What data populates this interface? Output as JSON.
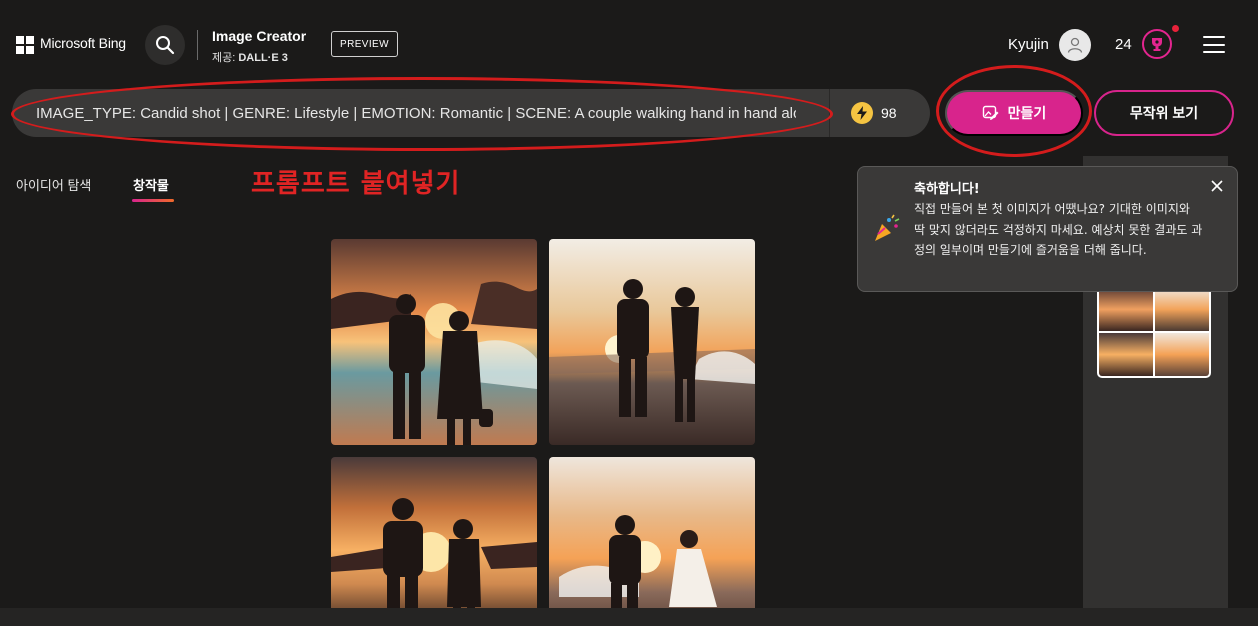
{
  "header": {
    "brand": "Microsoft Bing",
    "product_title": "Image Creator",
    "product_sub_prefix": "제공: ",
    "product_sub_model": "DALL·E 3",
    "preview_badge": "PREVIEW",
    "user_name": "Kyujin",
    "reward_points": "24"
  },
  "prompt": {
    "value": "IMAGE_TYPE: Candid shot | GENRE: Lifestyle | EMOTION: Romantic | SCENE: A couple walking hand in hand along a beach at sunset",
    "boost_count": "98"
  },
  "buttons": {
    "create": "만들기",
    "random": "무작위 보기"
  },
  "annotation": {
    "text": "프롬프트 붙여넣기",
    "color": "#e02424"
  },
  "tabs": [
    {
      "label": "아이디어 탐색",
      "active": false
    },
    {
      "label": "창작물",
      "active": true
    }
  ],
  "toast": {
    "title": "축하합니다!",
    "body": "직접 만들어 본 첫 이미지가 어땠나요? 기대한 이미지와 딱 맞지 않더라도 걱정하지 마세요. 예상치 못한 결과도 과정의 일부이며 만들기에 즐거움을 더해 줍니다."
  },
  "colors": {
    "accent": "#d8248c",
    "background": "#1b1a19",
    "boost": "#f5c442"
  },
  "icons": [
    "microsoft-logo-icon",
    "search-icon",
    "user-icon",
    "trophy-icon",
    "menu-icon",
    "lightning-icon",
    "image-create-icon",
    "party-popper-icon",
    "close-icon"
  ]
}
